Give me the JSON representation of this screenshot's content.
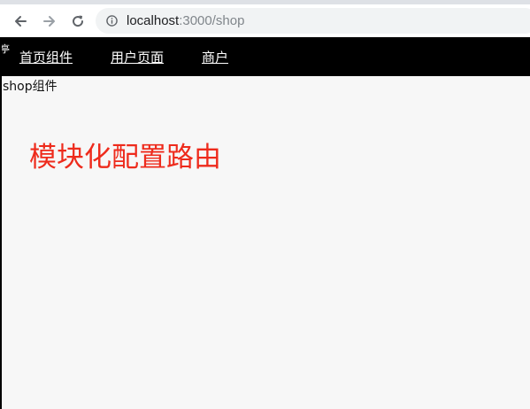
{
  "browser": {
    "url_host": "localhost",
    "url_path": ":3000/shop"
  },
  "navbar": {
    "edge_glyph": "亭",
    "links": [
      {
        "label": "首页组件"
      },
      {
        "label": "用户页面"
      },
      {
        "label": "商户"
      }
    ]
  },
  "main": {
    "component_label": "shop组件",
    "headline": "模块化配置路由",
    "headline_color": "#ee2b1c"
  },
  "icons": {
    "back": "arrow-left-icon",
    "forward": "arrow-right-icon",
    "reload": "reload-icon",
    "info": "info-icon"
  }
}
